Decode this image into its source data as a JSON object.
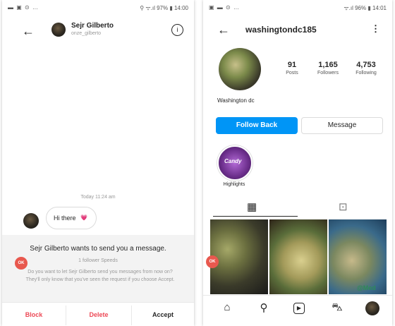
{
  "left": {
    "status": {
      "icons": "▬ ▣ ⊙ …",
      "right": "⚲ ᯤ.ıl 97% ▮ 14:00"
    },
    "header": {
      "name": "Sejr Gilberto",
      "handle": "onze_gilberto",
      "back_icon": "back-arrow-icon",
      "info_icon": "info-icon"
    },
    "thread": {
      "timestamp": "Today 11:24 am",
      "message": "Hi there",
      "heart": "💗"
    },
    "request": {
      "title": "Sejr Gilberto wants to send you a message.",
      "follower_count": "1 follower Speeds",
      "body": "Do you want to let Sejr Gilberto send you messages from now on? They'll only know that you've seen the request if you choose Accept.",
      "block": "Block",
      "delete": "Delete",
      "accept": "Accept",
      "badge": "OK"
    }
  },
  "right": {
    "status": {
      "icons": "▣ ▬ ⊙ …",
      "right": "ᯤ.ıl 96% ▮ 14:01"
    },
    "header": {
      "username": "washingtondc185",
      "back_icon": "back-arrow-icon",
      "more_icon": "more-vertical-icon"
    },
    "stats": [
      {
        "value": "91",
        "label": "Posts"
      },
      {
        "value": "1,165",
        "label": "Followers"
      },
      {
        "value": "4,753",
        "label": "Following"
      }
    ],
    "display_name": "Washington dc",
    "follow_back": "Follow Back",
    "message": "Message",
    "highlight": {
      "label": "Highlights",
      "text": "Candy"
    },
    "tabs": {
      "grid": "▦",
      "tagged": "⊡"
    },
    "badge": "OK",
    "watermark": "@Med",
    "nav": [
      "⌂",
      "⚲",
      "▶",
      "⛍",
      ""
    ],
    "colors": {
      "accent": "#0095f6",
      "block": "#ed4956"
    }
  }
}
